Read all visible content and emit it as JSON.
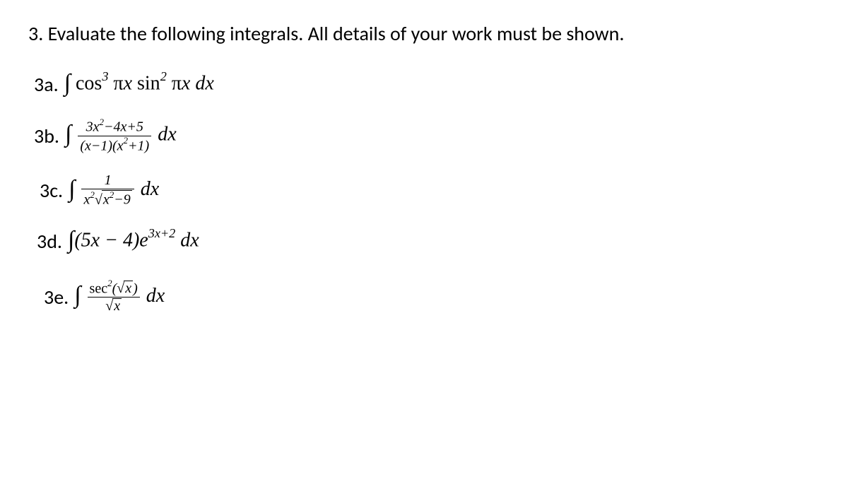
{
  "problem": {
    "number": "3.",
    "statement": "Evaluate the following integrals.  All details of your work must be shown."
  },
  "subproblems": {
    "a": {
      "label": "3a."
    },
    "b": {
      "label": "3b."
    },
    "c": {
      "label": "3c."
    },
    "d": {
      "label": "3d."
    },
    "e": {
      "label": "3e."
    }
  },
  "math_content": {
    "a": "∫ cos³ πx sin² πx dx",
    "b": "∫ (3x²−4x+5)/((x−1)(x²+1)) dx",
    "c": "∫ 1/(x²√(x²−9)) dx",
    "d": "∫ (5x − 4)e^(3x+2) dx",
    "e": "∫ sec²(√x)/√x dx"
  }
}
